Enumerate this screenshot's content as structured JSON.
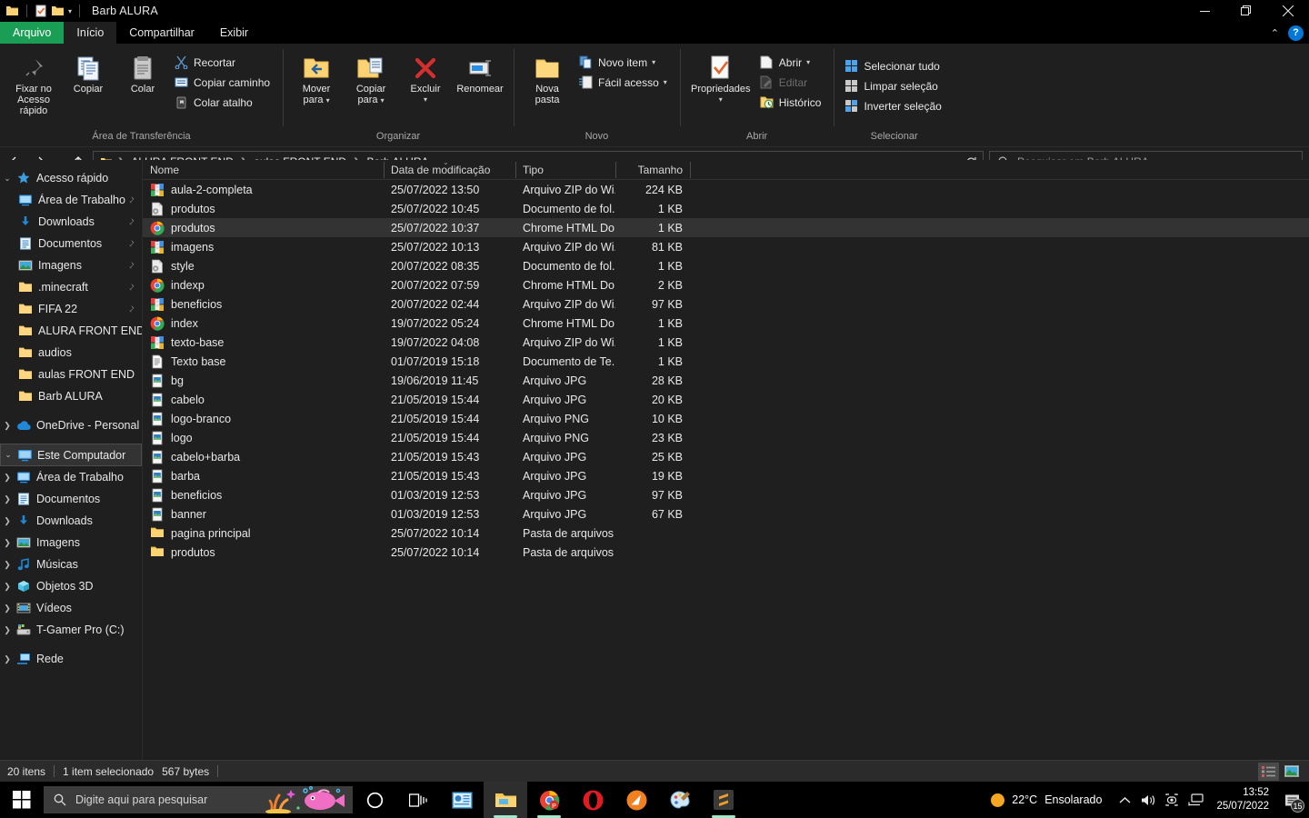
{
  "titlebar": {
    "title": "Barb ALURA"
  },
  "ribbon_tabs": [
    {
      "label": "Arquivo",
      "kind": "file"
    },
    {
      "label": "Início",
      "kind": "active"
    },
    {
      "label": "Compartilhar",
      "kind": "normal"
    },
    {
      "label": "Exibir",
      "kind": "normal"
    }
  ],
  "ribbon": {
    "groups": [
      {
        "name": "Área de Transferência",
        "label": "Área de Transferência"
      },
      {
        "name": "Organizar",
        "label": "Organizar"
      },
      {
        "name": "Novo",
        "label": "Novo"
      },
      {
        "name": "Abrir",
        "label": "Abrir"
      },
      {
        "name": "Selecionar",
        "label": "Selecionar"
      }
    ],
    "clipboard": {
      "pin_l1": "Fixar no",
      "pin_l2": "Acesso rápido",
      "copy": "Copiar",
      "paste": "Colar",
      "cut": "Recortar",
      "copy_path": "Copiar caminho",
      "paste_shortcut": "Colar atalho"
    },
    "organize": {
      "move_l1": "Mover",
      "move_l2": "para",
      "copy_l1": "Copiar",
      "copy_l2": "para",
      "delete": "Excluir",
      "rename": "Renomear"
    },
    "new": {
      "folder_l1": "Nova",
      "folder_l2": "pasta",
      "new_item": "Novo item",
      "easy_access": "Fácil acesso"
    },
    "open": {
      "properties": "Propriedades",
      "open": "Abrir",
      "edit": "Editar",
      "history": "Histórico"
    },
    "select": {
      "select_all": "Selecionar tudo",
      "clear_selection": "Limpar seleção",
      "invert_selection": "Inverter seleção"
    }
  },
  "addressbar": {
    "crumbs": [
      "ALURA FRONT END",
      "aulas FRONT END",
      "Barb ALURA"
    ],
    "search_placeholder": "Pesquisar em Barb ALURA"
  },
  "sidebar": {
    "quick_access": {
      "label": "Acesso rápido",
      "expanded": true
    },
    "quick_items": [
      {
        "label": "Área de Trabalho",
        "icon": "desktop-icon",
        "pinned": true
      },
      {
        "label": "Downloads",
        "icon": "downloads-icon",
        "pinned": true
      },
      {
        "label": "Documentos",
        "icon": "documents-icon",
        "pinned": true
      },
      {
        "label": "Imagens",
        "icon": "pictures-icon",
        "pinned": true
      },
      {
        "label": ".minecraft",
        "icon": "folder-icon",
        "pinned": true
      },
      {
        "label": "FIFA 22",
        "icon": "folder-icon",
        "pinned": true
      },
      {
        "label": "ALURA FRONT END",
        "icon": "folder-icon",
        "pinned": false
      },
      {
        "label": "audios",
        "icon": "folder-icon",
        "pinned": false
      },
      {
        "label": "aulas FRONT END",
        "icon": "folder-icon",
        "pinned": false
      },
      {
        "label": "Barb ALURA",
        "icon": "folder-icon",
        "pinned": false
      }
    ],
    "onedrive": {
      "label": "OneDrive - Personal"
    },
    "this_pc": {
      "label": "Este Computador",
      "selected": true
    },
    "pc_items": [
      {
        "label": "Área de Trabalho",
        "icon": "desktop-icon"
      },
      {
        "label": "Documentos",
        "icon": "documents-icon"
      },
      {
        "label": "Downloads",
        "icon": "downloads-icon"
      },
      {
        "label": "Imagens",
        "icon": "pictures-icon"
      },
      {
        "label": "Músicas",
        "icon": "music-icon"
      },
      {
        "label": "Objetos 3D",
        "icon": "objects3d-icon"
      },
      {
        "label": "Vídeos",
        "icon": "videos-icon"
      },
      {
        "label": "T-Gamer Pro (C:)",
        "icon": "drive-icon"
      }
    ],
    "network": {
      "label": "Rede"
    }
  },
  "filelist": {
    "columns": [
      "Nome",
      "Data de modificação",
      "Tipo",
      "Tamanho"
    ],
    "rows": [
      {
        "name": "aula-2-completa",
        "date": "25/07/2022 13:50",
        "type": "Arquivo ZIP do Wi...",
        "size": "224 KB",
        "icon": "zip-icon",
        "selected": false
      },
      {
        "name": "produtos",
        "date": "25/07/2022 10:45",
        "type": "Documento de fol...",
        "size": "1 KB",
        "icon": "css-icon",
        "selected": false
      },
      {
        "name": "produtos",
        "date": "25/07/2022 10:37",
        "type": "Chrome HTML Do...",
        "size": "1 KB",
        "icon": "chrome-icon",
        "selected": true
      },
      {
        "name": "imagens",
        "date": "25/07/2022 10:13",
        "type": "Arquivo ZIP do Wi...",
        "size": "81 KB",
        "icon": "zip-icon",
        "selected": false
      },
      {
        "name": "style",
        "date": "20/07/2022 08:35",
        "type": "Documento de fol...",
        "size": "1 KB",
        "icon": "css-icon",
        "selected": false
      },
      {
        "name": "indexp",
        "date": "20/07/2022 07:59",
        "type": "Chrome HTML Do...",
        "size": "2 KB",
        "icon": "chrome-icon",
        "selected": false
      },
      {
        "name": "beneficios",
        "date": "20/07/2022 02:44",
        "type": "Arquivo ZIP do Wi...",
        "size": "97 KB",
        "icon": "zip-icon",
        "selected": false
      },
      {
        "name": "index",
        "date": "19/07/2022 05:24",
        "type": "Chrome HTML Do...",
        "size": "1 KB",
        "icon": "chrome-icon",
        "selected": false
      },
      {
        "name": "texto-base",
        "date": "19/07/2022 04:08",
        "type": "Arquivo ZIP do Wi...",
        "size": "1 KB",
        "icon": "zip-icon",
        "selected": false
      },
      {
        "name": "Texto base",
        "date": "01/07/2019 15:18",
        "type": "Documento de Te...",
        "size": "1 KB",
        "icon": "txt-icon",
        "selected": false
      },
      {
        "name": "bg",
        "date": "19/06/2019 11:45",
        "type": "Arquivo JPG",
        "size": "28 KB",
        "icon": "image-icon",
        "selected": false
      },
      {
        "name": "cabelo",
        "date": "21/05/2019 15:44",
        "type": "Arquivo JPG",
        "size": "20 KB",
        "icon": "image-icon",
        "selected": false
      },
      {
        "name": "logo-branco",
        "date": "21/05/2019 15:44",
        "type": "Arquivo PNG",
        "size": "10 KB",
        "icon": "image-icon",
        "selected": false
      },
      {
        "name": "logo",
        "date": "21/05/2019 15:44",
        "type": "Arquivo PNG",
        "size": "23 KB",
        "icon": "image-icon",
        "selected": false
      },
      {
        "name": "cabelo+barba",
        "date": "21/05/2019 15:43",
        "type": "Arquivo JPG",
        "size": "25 KB",
        "icon": "image-icon",
        "selected": false
      },
      {
        "name": "barba",
        "date": "21/05/2019 15:43",
        "type": "Arquivo JPG",
        "size": "19 KB",
        "icon": "image-icon",
        "selected": false
      },
      {
        "name": "beneficios",
        "date": "01/03/2019 12:53",
        "type": "Arquivo JPG",
        "size": "97 KB",
        "icon": "image-icon",
        "selected": false
      },
      {
        "name": "banner",
        "date": "01/03/2019 12:53",
        "type": "Arquivo JPG",
        "size": "67 KB",
        "icon": "image-icon",
        "selected": false
      },
      {
        "name": "pagina principal",
        "date": "25/07/2022 10:14",
        "type": "Pasta de arquivos",
        "size": "",
        "icon": "folder-icon",
        "selected": false
      },
      {
        "name": "produtos",
        "date": "25/07/2022 10:14",
        "type": "Pasta de arquivos",
        "size": "",
        "icon": "folder-icon",
        "selected": false
      }
    ]
  },
  "statusbar": {
    "item_count": "20 itens",
    "selection": "1 item selecionado",
    "selection_size": "567 bytes"
  },
  "taskbar": {
    "search_placeholder": "Digite aqui para pesquisar",
    "weather_temp": "22°C",
    "weather_desc": "Ensolarado",
    "time": "13:52",
    "date": "25/07/2022",
    "notification_count": "15",
    "apps": [
      {
        "name": "cortana-icon"
      },
      {
        "name": "task-view-icon"
      },
      {
        "name": "powerpoint-icon"
      },
      {
        "name": "file-explorer-icon"
      },
      {
        "name": "chrome-icon"
      },
      {
        "name": "opera-icon"
      },
      {
        "name": "orange-app-icon"
      },
      {
        "name": "paint-icon"
      },
      {
        "name": "sublime-text-icon"
      }
    ]
  },
  "colors": {
    "accent_green": "#1a9e56",
    "accent_blue": "#0078d7",
    "folder_yellow": "#fbd373",
    "window_bg": "#1f1f1f"
  }
}
